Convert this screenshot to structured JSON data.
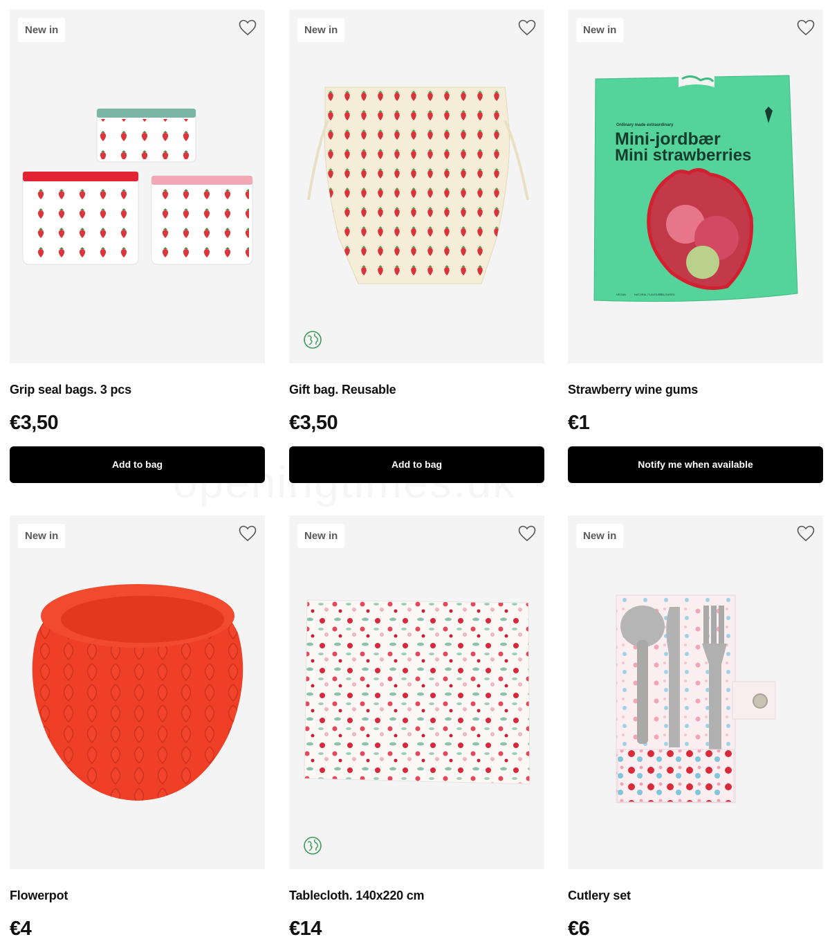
{
  "products": [
    {
      "badge": "New in",
      "title": "Grip seal bags. 3 pcs",
      "price": "€3,50",
      "button": "Add to bag",
      "eco": false,
      "image": "grip-seal-bags"
    },
    {
      "badge": "New in",
      "title": "Gift bag. Reusable",
      "price": "€3,50",
      "button": "Add to bag",
      "eco": true,
      "image": "gift-bag"
    },
    {
      "badge": "New in",
      "title": "Strawberry wine gums",
      "price": "€1",
      "button": "Notify me when available",
      "eco": false,
      "image": "wine-gums-bag",
      "package_text": {
        "small": "Ordinary made extraordinary",
        "line1": "Mini-jordbær",
        "line2": "Mini strawberries",
        "icons": [
          "VEGAN",
          "NATURAL FLAVOURS",
          "COLOURED"
        ]
      }
    },
    {
      "badge": "New in",
      "title": "Flowerpot",
      "price": "€4",
      "eco": false,
      "image": "flowerpot"
    },
    {
      "badge": "New in",
      "title": "Tablecloth. 140x220 cm",
      "price": "€14",
      "eco": true,
      "image": "tablecloth"
    },
    {
      "badge": "New in",
      "title": "Cutlery set",
      "price": "€6",
      "eco": false,
      "image": "cutlery-set"
    }
  ],
  "watermark": "openingtimes.uk",
  "icons": {
    "wishlist": "heart-outline-icon",
    "eco": "globe-eco-icon"
  },
  "colors": {
    "button_bg": "#000000",
    "tile_bg": "#f4f4f4",
    "badge_text": "#5a5a5a",
    "eco_green": "#3a9a5b"
  }
}
